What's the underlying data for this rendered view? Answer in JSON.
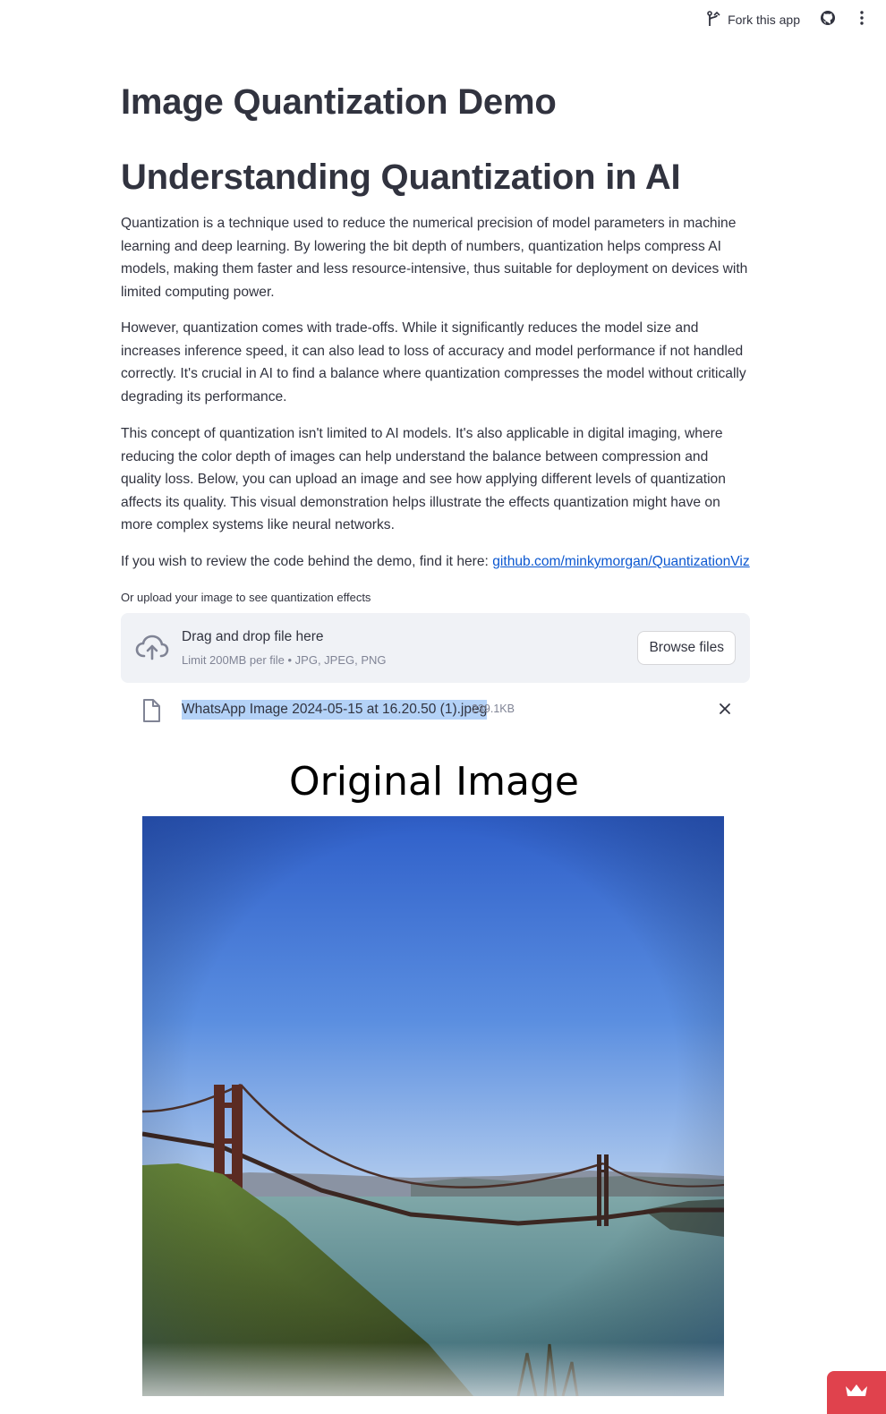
{
  "toolbar": {
    "fork_label": "Fork this app"
  },
  "main": {
    "title": "Image Quantization Demo",
    "subtitle": "Understanding Quantization in AI",
    "paragraphs": [
      "Quantization is a technique used to reduce the numerical precision of model parameters in machine learning and deep learning. By lowering the bit depth of numbers, quantization helps compress AI models, making them faster and less resource-intensive, thus suitable for deployment on devices with limited computing power.",
      "However, quantization comes with trade-offs. While it significantly reduces the model size and increases inference speed, it can also lead to loss of accuracy and model performance if not handled correctly. It's crucial in AI to find a balance where quantization compresses the model without critically degrading its performance.",
      "This concept of quantization isn't limited to AI models. It's also applicable in digital imaging, where reducing the color depth of images can help understand the balance between compression and quality loss. Below, you can upload an image and see how applying different levels of quantization affects its quality. This visual demonstration helps illustrate the effects quantization might have on more complex systems like neural networks."
    ],
    "code_text": "If you wish to review the code behind the demo, find it here: ",
    "code_link": "github.com/minkymorgan/QuantizationViz"
  },
  "uploader": {
    "label": "Or upload your image to see quantization effects",
    "drop_text": "Drag and drop file here",
    "limit_text": "Limit 200MB per file • JPG, JPEG, PNG",
    "browse_label": "Browse files",
    "file_name": "WhatsApp Image 2024-05-15 at 16.20.50 (1).jpeg",
    "file_size": "239.1KB"
  },
  "figure": {
    "title": "Original Image"
  },
  "icons": {
    "fork": "fork-icon",
    "github": "github-icon",
    "menu": "kebab-menu-icon",
    "upload": "cloud-upload-icon",
    "file": "file-icon",
    "close": "close-icon",
    "badge": "crown-icon"
  },
  "colors": {
    "link": "#0b57d0",
    "dropzone_bg": "#f0f2f6",
    "selection": "#b4d2f7",
    "badge": "#e0424d"
  }
}
